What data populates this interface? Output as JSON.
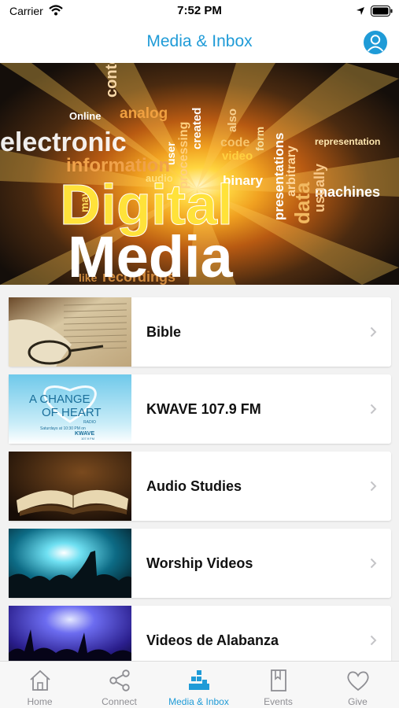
{
  "status_bar": {
    "carrier": "Carrier",
    "time": "7:52 PM"
  },
  "header": {
    "title": "Media & Inbox"
  },
  "hero": {
    "headline": "Digital",
    "subline": "Media",
    "words": [
      "electronic",
      "information",
      "analog",
      "content",
      "Online",
      "binary",
      "machines",
      "audio",
      "video",
      "data",
      "code",
      "form",
      "usually",
      "arbitrary",
      "created",
      "processing",
      "presentations",
      "representation",
      "recordings",
      "like",
      "may",
      "user",
      "also"
    ]
  },
  "media_items": [
    {
      "label": "Bible"
    },
    {
      "label": "KWAVE 107.9 FM",
      "thumb_text": [
        "A CHANGE",
        "OF HEART",
        "RADIO",
        "Saturdays at 10:30 PM on",
        "KWAVE",
        "107.9 FM"
      ]
    },
    {
      "label": "Audio Studies"
    },
    {
      "label": "Worship Videos"
    },
    {
      "label": "Videos de Alabanza"
    }
  ],
  "tabs": [
    {
      "label": "Home",
      "icon": "home-icon",
      "active": false
    },
    {
      "label": "Connect",
      "icon": "share-icon",
      "active": false
    },
    {
      "label": "Media & Inbox",
      "icon": "media-bars-icon",
      "active": true
    },
    {
      "label": "Events",
      "icon": "bookmark-book-icon",
      "active": false
    },
    {
      "label": "Give",
      "icon": "heart-icon",
      "active": false
    }
  ],
  "colors": {
    "accent": "#1f9bd7",
    "inactive": "#8e8e93"
  }
}
